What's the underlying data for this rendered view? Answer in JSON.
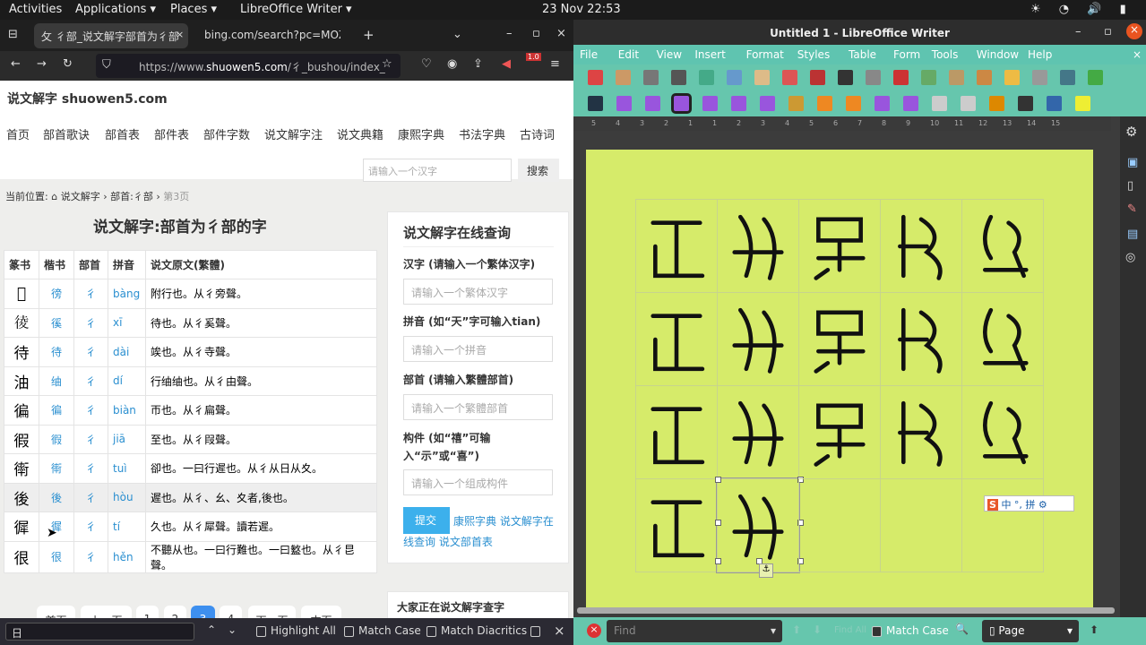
{
  "topbar": {
    "activities": "Activities",
    "applications": "Applications ▾",
    "places": "Places ▾",
    "app": "LibreOffice Writer ▾",
    "clock": "23 Nov  22:53"
  },
  "browser": {
    "tabs": [
      {
        "label": "⺙ 彳部_说文解字部首为彳部",
        "active": true
      },
      {
        "label": "bing.com/search?pc=MOZI&",
        "active": false
      }
    ],
    "url_pre": "https://www.",
    "url_host": "shuowen5.com",
    "url_post": "/彳_bushou/index_",
    "badge": "1.0",
    "site": {
      "title": "说文解字 shuowen5.com",
      "nav": [
        "首页",
        "部首歌诀",
        "部首表",
        "部件表",
        "部件字数",
        "说文解字注",
        "说文典籍",
        "康熙字典",
        "书法字典",
        "古诗词"
      ],
      "search_placeholder": "请输入一个汉字",
      "search_button": "搜索",
      "breadcrumb": {
        "prefix": "当前位置:",
        "home": "说文解字",
        "section": "部首:彳部",
        "page": "第3页"
      },
      "heading": "说文解字:部首为彳部的字",
      "table": {
        "headers": [
          "篆书",
          "楷书",
          "部首",
          "拼音",
          "说文原文(繁體)"
        ],
        "rows": [
          [
            "𢓍",
            "徬",
            "彳",
            "bàng",
            "附行也。从彳旁聲。"
          ],
          [
            "𢔁",
            "徯",
            "彳",
            "xī",
            "待也。从彳奚聲。"
          ],
          [
            "待",
            "待",
            "彳",
            "dài",
            "竢也。从彳寺聲。"
          ],
          [
            "油",
            "䌷",
            "彳",
            "dí",
            "行䌷䌷也。从彳由聲。"
          ],
          [
            "徧",
            "徧",
            "彳",
            "biàn",
            "帀也。从彳扁聲。"
          ],
          [
            "徦",
            "徦",
            "彳",
            "jiā",
            "至也。从彳叚聲。"
          ],
          [
            "𧗿",
            "𧗿",
            "彳",
            "tuì",
            "卻也。一曰行遲也。从彳从日从夊。"
          ],
          [
            "後",
            "後",
            "彳",
            "hòu",
            "遲也。从彳、幺、夊者,後也。"
          ],
          [
            "徲",
            "徲",
            "彳",
            "tí",
            "久也。从彳犀聲。讀若遲。"
          ],
          [
            "很",
            "很",
            "彳",
            "hěn",
            "不聽从也。一曰行難也。一曰盭也。从彳㫐聲。"
          ]
        ]
      },
      "pagination": [
        "首页",
        "上一页",
        "1",
        "2",
        "3",
        "4",
        "下一页",
        "末页"
      ],
      "current_page": "3",
      "sidebar": {
        "title": "说文解字在线查询",
        "fields": [
          {
            "label": "汉字 (请输入一个繁体汉字)",
            "placeholder": "请输入一个繁体汉字"
          },
          {
            "label": "拼音 (如“天”字可输入tian)",
            "placeholder": "请输入一个拼音"
          },
          {
            "label": "部首 (请输入繁體部首)",
            "placeholder": "请输入一个繁體部首"
          },
          {
            "label": "构件 (如“禧”可输入“示”或“喜”)",
            "placeholder": "请输入一个组成构件"
          }
        ],
        "submit": "提交",
        "links": [
          "康熙字典",
          "说文解字在线查询",
          "说文部首表"
        ],
        "popular_title": "大家正在说文解字查字"
      }
    },
    "find": {
      "value": "日",
      "highlight_all": "Highlight All",
      "match_case": "Match Case",
      "match_diacritics": "Match Diacritics"
    }
  },
  "writer": {
    "title": "Untitled 1 - LibreOffice Writer",
    "menu": [
      "File",
      "Edit",
      "View",
      "Insert",
      "Format",
      "Styles",
      "Table",
      "Form",
      "Tools",
      "Window",
      "Help"
    ],
    "ruler": [
      "5",
      "4",
      "3",
      "2",
      "1",
      "1",
      "2",
      "3",
      "4",
      "5",
      "6",
      "7",
      "8",
      "9",
      "10",
      "11",
      "12",
      "13",
      "14",
      "15"
    ],
    "ime": "中 °, 拼 ⚙",
    "find": {
      "placeholder": "Find",
      "find_all": "Find All",
      "match_case": "Match Case",
      "scope": "Page"
    },
    "page_color": "#d6eb6a",
    "toolbar_color": "#66c6ad"
  }
}
